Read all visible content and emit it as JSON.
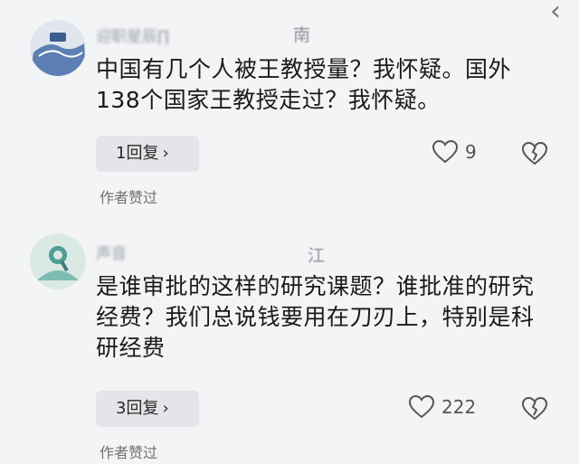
{
  "comments": [
    {
      "username": "迎职星辰∏",
      "location": "南",
      "text": "中国有几个人被王教授量？我怀疑。国外138个国家王教授走过？我怀疑。",
      "reply_label": "1回复",
      "likes": "9",
      "liked_by": "作者赞过"
    },
    {
      "username": "声音",
      "location": "江",
      "text": "是谁审批的这样的研究课题？谁批准的研究经费？我们总说钱要用在刀刃上，特别是科研经费",
      "reply_label": "3回复",
      "likes": "222",
      "liked_by": "作者赞过"
    }
  ],
  "colors": {
    "background": "#f3f4f6",
    "reply_bg": "#e3e5e8",
    "text": "#1a1a1a"
  },
  "icons": [
    "back-chevron-icon",
    "heart-icon",
    "broken-heart-icon",
    "chevron-right-icon"
  ]
}
